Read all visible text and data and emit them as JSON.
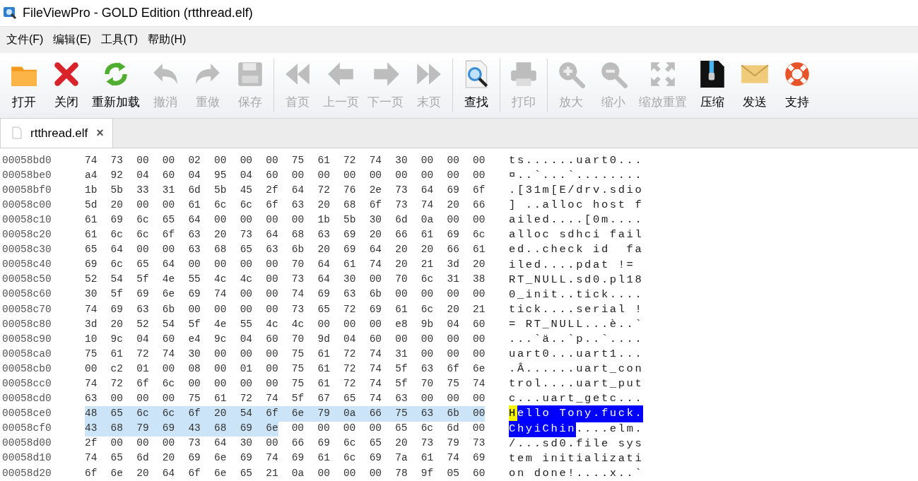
{
  "window": {
    "title": "FileViewPro - GOLD Edition (rtthread.elf)"
  },
  "menu": [
    "文件(F)",
    "编辑(E)",
    "工具(T)",
    "帮助(H)"
  ],
  "toolbar": [
    {
      "buttons": [
        {
          "label": "打开",
          "disabled": false
        },
        {
          "label": "关闭",
          "disabled": false
        },
        {
          "label": "重新加载",
          "disabled": false
        },
        {
          "label": "撤消",
          "disabled": true
        },
        {
          "label": "重做",
          "disabled": true
        },
        {
          "label": "保存",
          "disabled": true
        }
      ]
    },
    {
      "buttons": [
        {
          "label": "首页",
          "disabled": true
        },
        {
          "label": "上一页",
          "disabled": true
        },
        {
          "label": "下一页",
          "disabled": true
        },
        {
          "label": "末页",
          "disabled": true
        }
      ]
    },
    {
      "buttons": [
        {
          "label": "查找",
          "disabled": false
        }
      ]
    },
    {
      "buttons": [
        {
          "label": "打印",
          "disabled": true
        }
      ]
    },
    {
      "buttons": [
        {
          "label": "放大",
          "disabled": true
        },
        {
          "label": "缩小",
          "disabled": true
        },
        {
          "label": "缩放重置",
          "disabled": true
        },
        {
          "label": "压缩",
          "disabled": false
        },
        {
          "label": "发送",
          "disabled": false
        },
        {
          "label": "支持",
          "disabled": false
        }
      ]
    }
  ],
  "tabs": [
    {
      "label": "rtthread.elf",
      "close": "×",
      "selected": true
    }
  ],
  "rows": [
    {
      "offset": "00058bd0",
      "hex": "74 73 00 00 02 00 00 00 75 61 72 74 30 00 00 00",
      "ascii": "ts......uart0..."
    },
    {
      "offset": "00058be0",
      "hex": "a4 92 04 60 04 95 04 60 00 00 00 00 00 00 00 00",
      "ascii": "¤..`...`........"
    },
    {
      "offset": "00058bf0",
      "hex": "1b 5b 33 31 6d 5b 45 2f 64 72 76 2e 73 64 69 6f",
      "ascii": ".[31m[E/drv.sdio"
    },
    {
      "offset": "00058c00",
      "hex": "5d 20 00 00 61 6c 6c 6f 63 20 68 6f 73 74 20 66",
      "ascii": "] ..alloc host f"
    },
    {
      "offset": "00058c10",
      "hex": "61 69 6c 65 64 00 00 00 00 1b 5b 30 6d 0a 00 00",
      "ascii": "ailed....[0m...."
    },
    {
      "offset": "00058c20",
      "hex": "61 6c 6c 6f 63 20 73 64 68 63 69 20 66 61 69 6c",
      "ascii": "alloc sdhci fail"
    },
    {
      "offset": "00058c30",
      "hex": "65 64 00 00 63 68 65 63 6b 20 69 64 20 20 66 61",
      "ascii": "ed..check id  fa"
    },
    {
      "offset": "00058c40",
      "hex": "69 6c 65 64 00 00 00 00 70 64 61 74 20 21 3d 20",
      "ascii": "iled....pdat != "
    },
    {
      "offset": "00058c50",
      "hex": "52 54 5f 4e 55 4c 4c 00 73 64 30 00 70 6c 31 38",
      "ascii": "RT_NULL.sd0.pl18"
    },
    {
      "offset": "00058c60",
      "hex": "30 5f 69 6e 69 74 00 00 74 69 63 6b 00 00 00 00",
      "ascii": "0_init..tick...."
    },
    {
      "offset": "00058c70",
      "hex": "74 69 63 6b 00 00 00 00 73 65 72 69 61 6c 20 21",
      "ascii": "tick....serial !"
    },
    {
      "offset": "00058c80",
      "hex": "3d 20 52 54 5f 4e 55 4c 4c 00 00 00 e8 9b 04 60",
      "ascii": "= RT_NULL...è..`"
    },
    {
      "offset": "00058c90",
      "hex": "10 9c 04 60 e4 9c 04 60 70 9d 04 60 00 00 00 00",
      "ascii": "...`ä..`p..`...."
    },
    {
      "offset": "00058ca0",
      "hex": "75 61 72 74 30 00 00 00 75 61 72 74 31 00 00 00",
      "ascii": "uart0...uart1..."
    },
    {
      "offset": "00058cb0",
      "hex": "00 c2 01 00 08 00 01 00 75 61 72 74 5f 63 6f 6e",
      "ascii": ".Â......uart_con"
    },
    {
      "offset": "00058cc0",
      "hex": "74 72 6f 6c 00 00 00 00 75 61 72 74 5f 70 75 74",
      "ascii": "trol....uart_put"
    },
    {
      "offset": "00058cd0",
      "hex": "63 00 00 00 75 61 72 74 5f 67 65 74 63 00 00 00",
      "ascii": "c...uart_getc..."
    },
    {
      "offset": "00058ce0",
      "hex_selected": "48 65 6c 6c 6f 20 54 6f 6e 79 0a 66 75 63 6b 00",
      "ascii_cursor": "H",
      "ascii_selected": "ello Tony.fuck."
    },
    {
      "offset": "00058cf0",
      "hex_selected": "43 68 79 69 43 68 69 6e",
      "hex": "00 00 00 00 65 6c 6d 00",
      "ascii_selected": "ChyiChin",
      "ascii": "....elm."
    },
    {
      "offset": "00058d00",
      "hex": "2f 00 00 00 73 64 30 00 66 69 6c 65 20 73 79 73",
      "ascii": "/...sd0.file sys"
    },
    {
      "offset": "00058d10",
      "hex": "74 65 6d 20 69 6e 69 74 69 61 6c 69 7a 61 74 69",
      "ascii": "tem initializati"
    },
    {
      "offset": "00058d20",
      "hex": "6f 6e 20 64 6f 6e 65 21 0a 00 00 00 78 9f 05 60",
      "ascii": "on done!....x..`"
    }
  ]
}
